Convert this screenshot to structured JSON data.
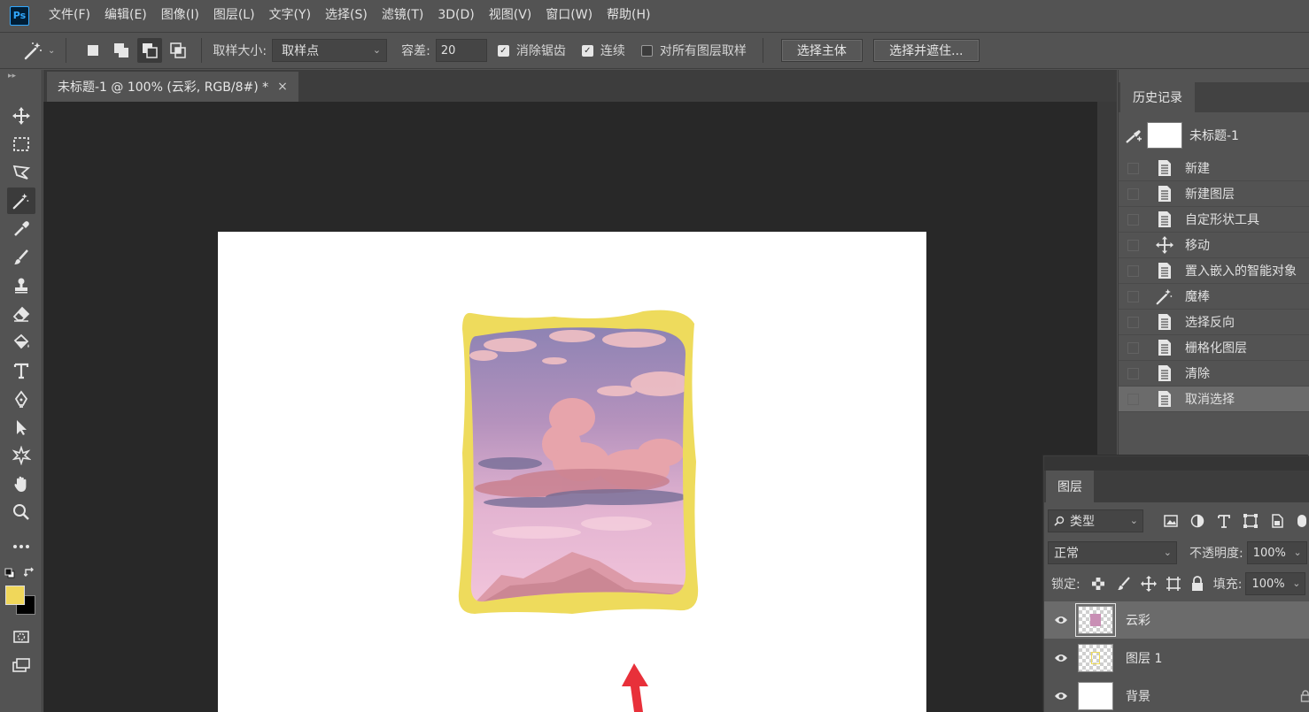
{
  "app": {
    "logo": "Ps",
    "menu": [
      "文件(F)",
      "编辑(E)",
      "图像(I)",
      "图层(L)",
      "文字(Y)",
      "选择(S)",
      "滤镜(T)",
      "3D(D)",
      "视图(V)",
      "窗口(W)",
      "帮助(H)"
    ]
  },
  "options": {
    "tool_icon": "magic-wand-icon",
    "sample_size_label": "取样大小:",
    "sample_size_value": "取样点",
    "tolerance_label": "容差:",
    "tolerance_value": "20",
    "anti_alias": {
      "label": "消除锯齿",
      "checked": true
    },
    "contiguous": {
      "label": "连续",
      "checked": true
    },
    "sample_all_layers": {
      "label": "对所有图层取样",
      "checked": false
    },
    "select_subject": "选择主体",
    "select_and_mask": "选择并遮住..."
  },
  "document": {
    "tab_title": "未标题-1 @ 100% (云彩, RGB/8#) *",
    "close_glyph": "×"
  },
  "history": {
    "tab": "历史记录",
    "snapshot_label": "未标题-1",
    "items": [
      {
        "label": "新建",
        "icon": "document-icon"
      },
      {
        "label": "新建图层",
        "icon": "document-icon"
      },
      {
        "label": "自定形状工具",
        "icon": "document-icon"
      },
      {
        "label": "移动",
        "icon": "move-icon"
      },
      {
        "label": "置入嵌入的智能对象",
        "icon": "document-icon"
      },
      {
        "label": "魔棒",
        "icon": "magic-wand-icon"
      },
      {
        "label": "选择反向",
        "icon": "document-icon"
      },
      {
        "label": "栅格化图层",
        "icon": "document-icon"
      },
      {
        "label": "清除",
        "icon": "document-icon"
      },
      {
        "label": "取消选择",
        "icon": "document-icon",
        "active": true
      }
    ]
  },
  "layers": {
    "tab": "图层",
    "filter_value": "类型",
    "blend_mode": "正常",
    "opacity_label": "不透明度:",
    "opacity_value": "100%",
    "lock_label": "锁定:",
    "fill_label": "填充:",
    "fill_value": "100%",
    "items": [
      {
        "name": "云彩",
        "selected": true
      },
      {
        "name": "图层 1",
        "selected": false
      },
      {
        "name": "背景",
        "selected": false
      }
    ]
  },
  "colors": {
    "foreground": "#f0d75a",
    "background": "#000000",
    "frame": "#eedb5c",
    "arrow": "#e8303a"
  }
}
